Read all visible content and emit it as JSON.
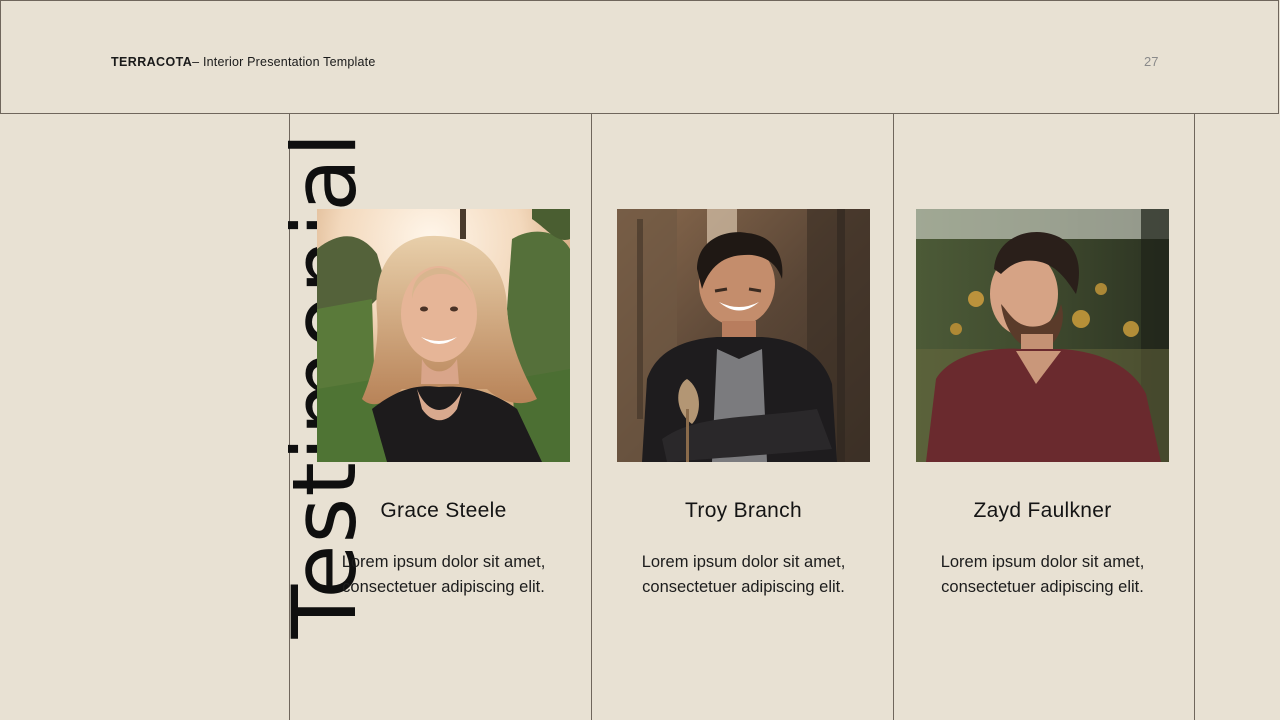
{
  "header": {
    "brand": "TERRACOTA",
    "subtitle": "– Interior Presentation Template",
    "page_number": "27"
  },
  "title": "Testimonial",
  "testimonials": [
    {
      "name": "Grace Steele",
      "text_line1": "Lorem ipsum dolor sit amet,",
      "text_line2": "consectetuer adipiscing elit.",
      "photo": "woman-portrait-photo"
    },
    {
      "name": "Troy Branch",
      "text_line1": "Lorem ipsum dolor sit amet,",
      "text_line2": "consectetuer adipiscing elit.",
      "photo": "smiling-man-portrait-photo"
    },
    {
      "name": "Zayd Faulkner",
      "text_line1": "Lorem ipsum dolor sit amet,",
      "text_line2": "consectetuer adipiscing elit.",
      "photo": "bearded-man-portrait-photo"
    }
  ],
  "colors": {
    "background": "#e8e1d3",
    "lines": "#6f665c",
    "text": "#141414"
  }
}
